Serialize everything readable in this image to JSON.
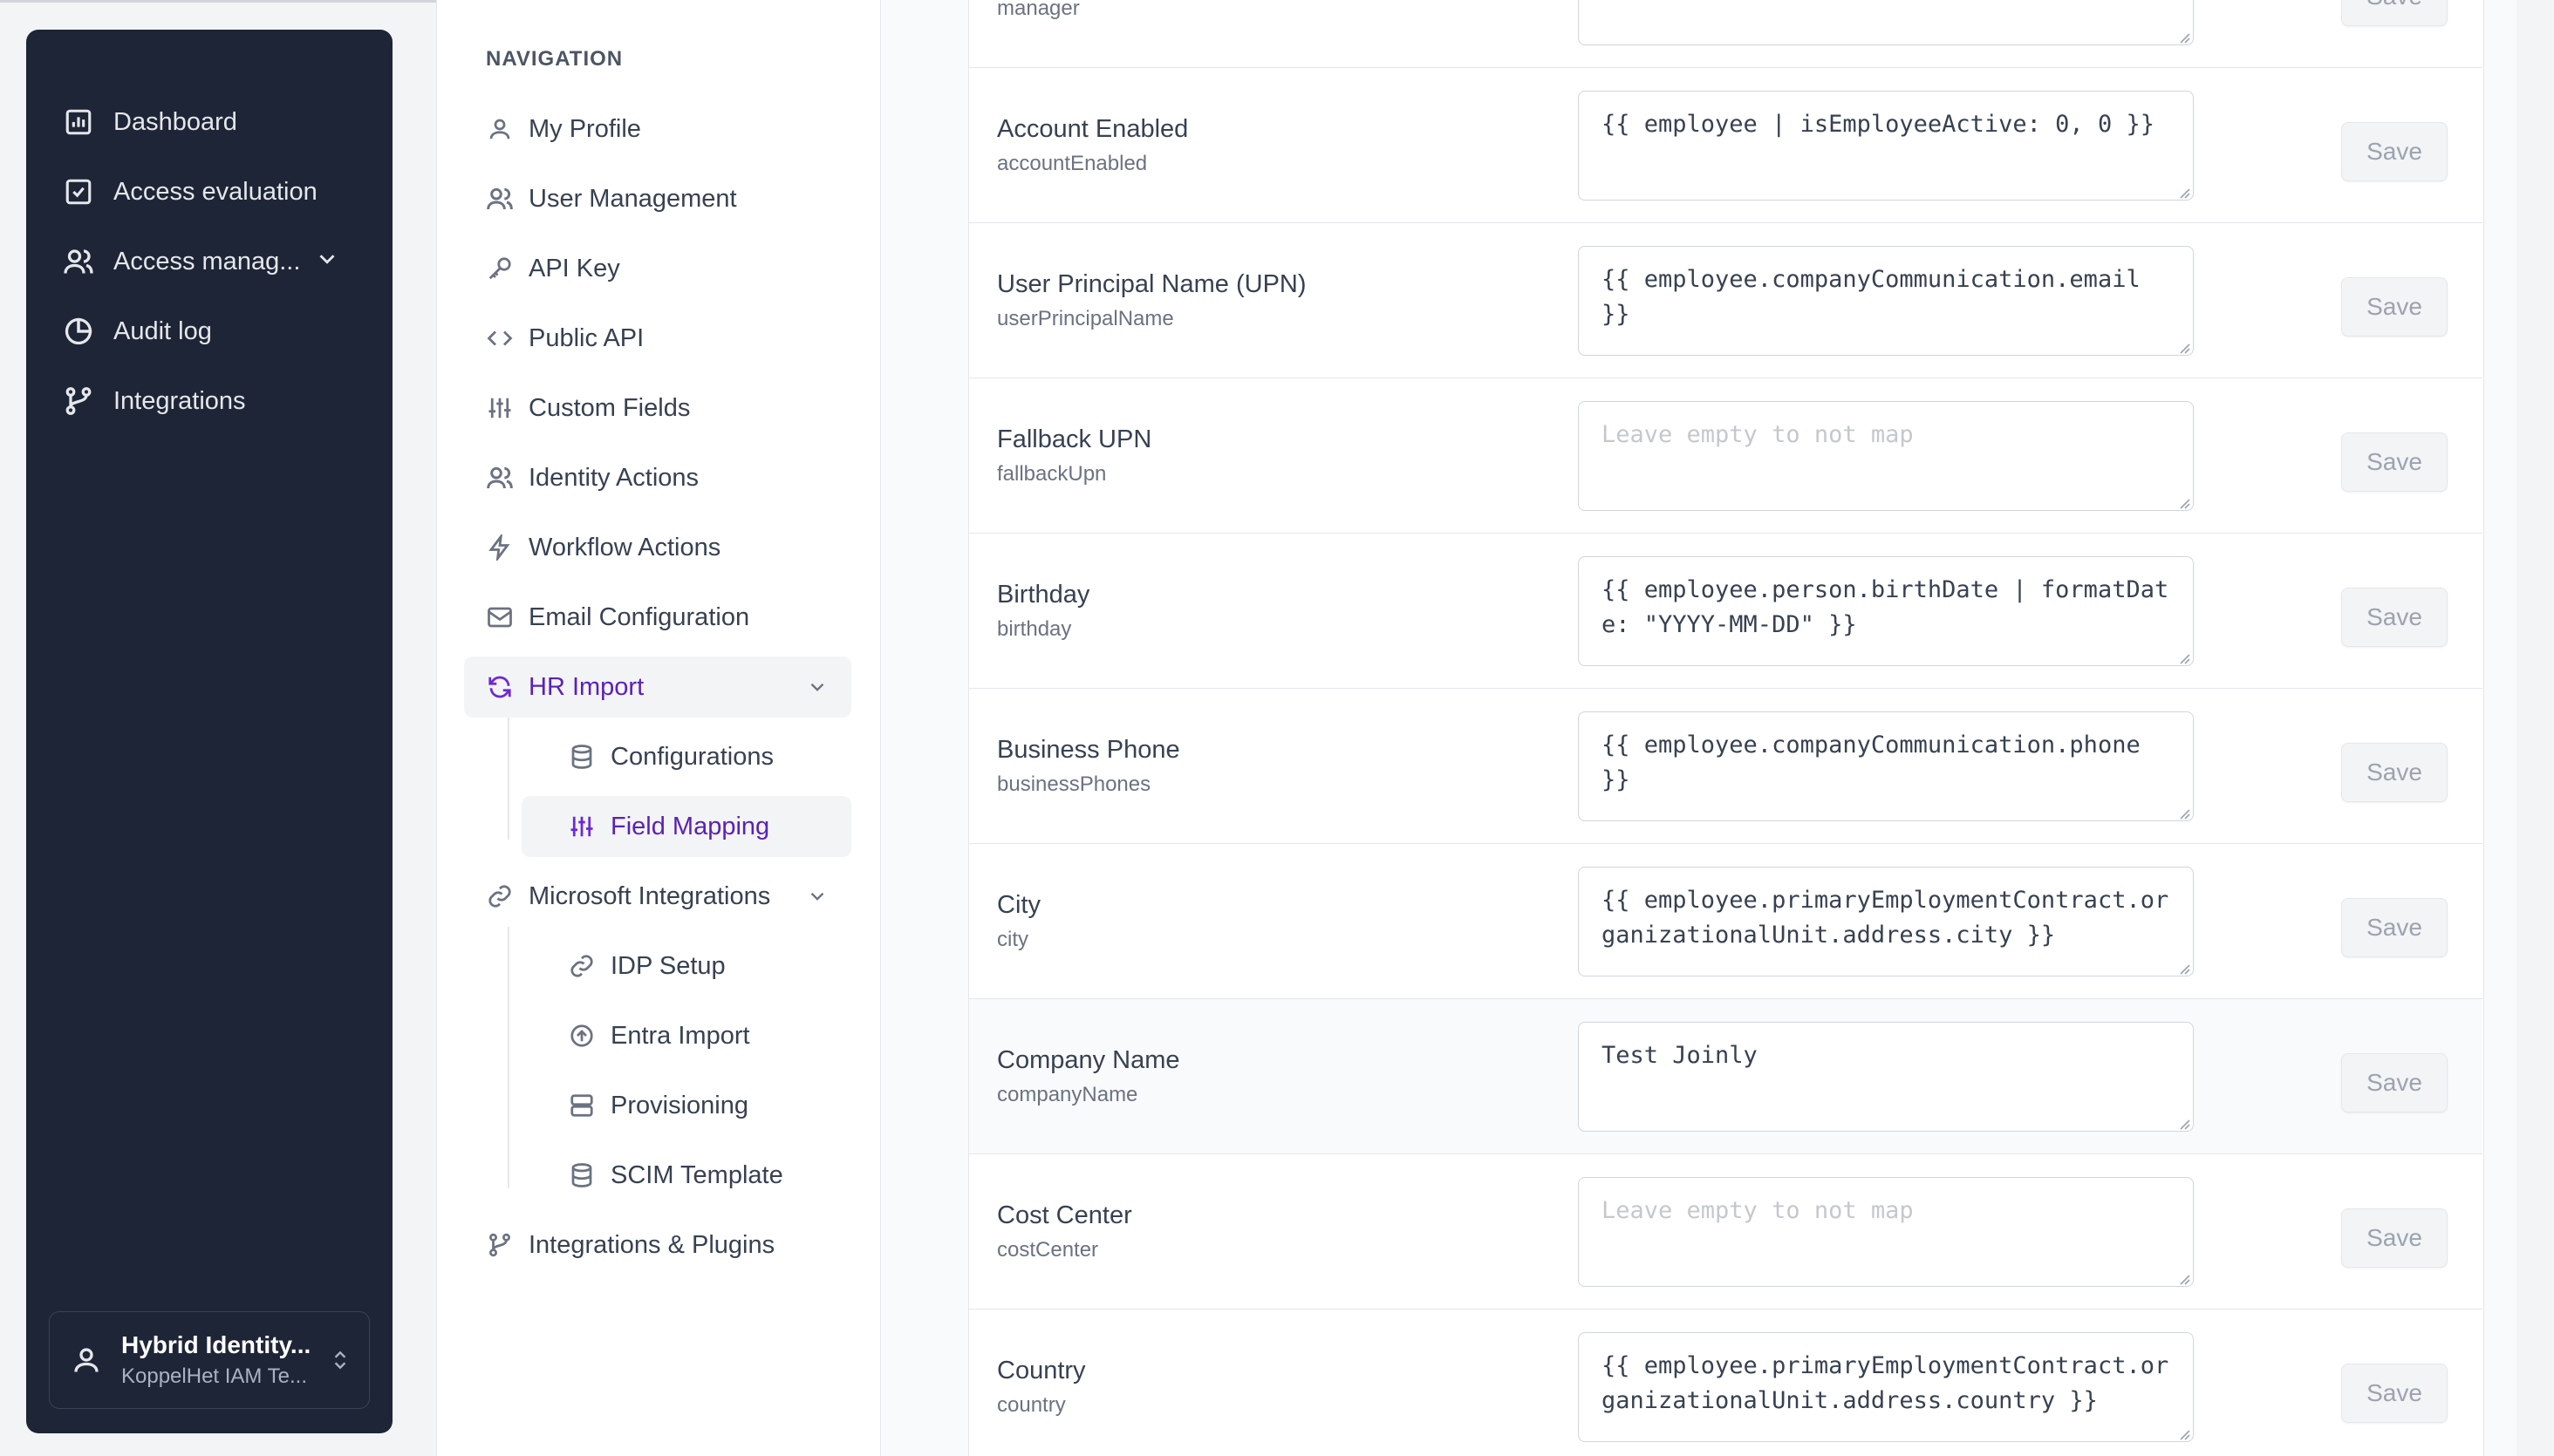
{
  "sidebar": {
    "items": [
      {
        "label": "Dashboard",
        "icon": "bar-chart-icon"
      },
      {
        "label": "Access evaluation",
        "icon": "check-square-icon"
      },
      {
        "label": "Access manag...",
        "icon": "users-icon"
      },
      {
        "label": "Audit log",
        "icon": "pie-chart-icon"
      },
      {
        "label": "Integrations",
        "icon": "git-branch-icon"
      }
    ],
    "tenant": {
      "name": "Hybrid Identity...",
      "org": "KoppelHet IAM Te..."
    }
  },
  "nav": {
    "heading": "NAVIGATION",
    "items": [
      {
        "label": "My Profile"
      },
      {
        "label": "User Management"
      },
      {
        "label": "API Key"
      },
      {
        "label": "Public API"
      },
      {
        "label": "Custom Fields"
      },
      {
        "label": "Identity Actions"
      },
      {
        "label": "Workflow Actions"
      },
      {
        "label": "Email Configuration"
      },
      {
        "label": "HR Import"
      },
      {
        "label": "Microsoft Integrations"
      },
      {
        "label": "Integrations & Plugins"
      }
    ],
    "hr_sub": [
      {
        "label": "Configurations"
      },
      {
        "label": "Field Mapping"
      }
    ],
    "ms_sub": [
      {
        "label": "IDP Setup"
      },
      {
        "label": "Entra Import"
      },
      {
        "label": "Provisioning"
      },
      {
        "label": "SCIM Template"
      }
    ]
  },
  "mapping": {
    "partial_key": "manager",
    "save_label": "Save",
    "empty_placeholder": "Leave empty to not map",
    "rows": [
      {
        "label": "Account Enabled",
        "key": "accountEnabled",
        "value": "{{ employee | isEmployeeActive: 0, 0 }}"
      },
      {
        "label": "User Principal Name (UPN)",
        "key": "userPrincipalName",
        "value": "{{ employee.companyCommunication.email }}"
      },
      {
        "label": "Fallback UPN",
        "key": "fallbackUpn",
        "value": ""
      },
      {
        "label": "Birthday",
        "key": "birthday",
        "value": "{{ employee.person.birthDate | formatDate: \"YYYY-MM-DD\" }}"
      },
      {
        "label": "Business Phone",
        "key": "businessPhones",
        "value": "{{ employee.companyCommunication.phone }}"
      },
      {
        "label": "City",
        "key": "city",
        "value": "{{ employee.primaryEmploymentContract.organizationalUnit.address.city }}"
      },
      {
        "label": "Company Name",
        "key": "companyName",
        "value": "Test Joinly"
      },
      {
        "label": "Cost Center",
        "key": "costCenter",
        "value": ""
      },
      {
        "label": "Country",
        "key": "country",
        "value": "{{ employee.primaryEmploymentContract.organizationalUnit.address.country }}"
      }
    ]
  }
}
